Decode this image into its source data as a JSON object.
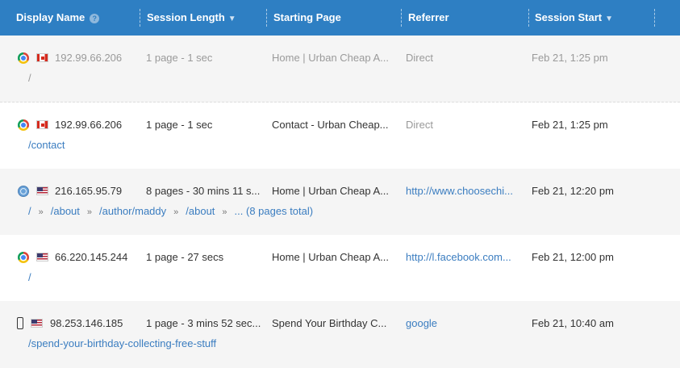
{
  "header": {
    "display_name": "Display Name",
    "help_glyph": "?",
    "session_length": "Session Length",
    "starting_page": "Starting Page",
    "referrer": "Referrer",
    "session_start": "Session Start",
    "sort_glyph": "▼"
  },
  "rows": [
    {
      "browser": "chrome-icon",
      "flag": "canada-flag-icon",
      "ip": "192.99.66.206",
      "length": "1 page - 1 sec",
      "start_page": "Home | Urban Cheap A...",
      "referrer": "Direct",
      "session_start": "Feb 21, 1:25 pm",
      "path": [
        "/"
      ]
    },
    {
      "browser": "chrome-icon",
      "flag": "canada-flag-icon",
      "ip": "192.99.66.206",
      "length": "1 page - 1 sec",
      "start_page": "Contact - Urban Cheap...",
      "referrer": "Direct",
      "session_start": "Feb 21, 1:25 pm",
      "path": [
        "/contact"
      ]
    },
    {
      "browser": "globe-icon",
      "flag": "usa-flag-icon",
      "ip": "216.165.95.79",
      "length": "8 pages - 30 mins 11 s...",
      "start_page": "Home | Urban Cheap A...",
      "referrer": "http://www.choosechi...",
      "session_start": "Feb 21, 12:20 pm",
      "path": [
        "/",
        "/about",
        "/author/maddy",
        "/about",
        "... (8 pages total)"
      ],
      "separator": "»"
    },
    {
      "browser": "chrome-icon",
      "flag": "usa-flag-icon",
      "ip": "66.220.145.244",
      "length": "1 page - 27 secs",
      "start_page": "Home | Urban Cheap A...",
      "referrer": "http://l.facebook.com...",
      "session_start": "Feb 21, 12:00 pm",
      "path": [
        "/"
      ]
    },
    {
      "browser": "mobile-phone-icon",
      "flag": "usa-flag-icon",
      "ip": "98.253.146.185",
      "length": "1 page - 3 mins 52 sec...",
      "start_page": "Spend Your Birthday C...",
      "referrer": "google",
      "session_start": "Feb 21, 10:40 am",
      "path": [
        "/spend-your-birthday-collecting-free-stuff"
      ]
    }
  ],
  "colors": {
    "header_bg": "#2e7fc3",
    "link": "#3b7dc0"
  }
}
